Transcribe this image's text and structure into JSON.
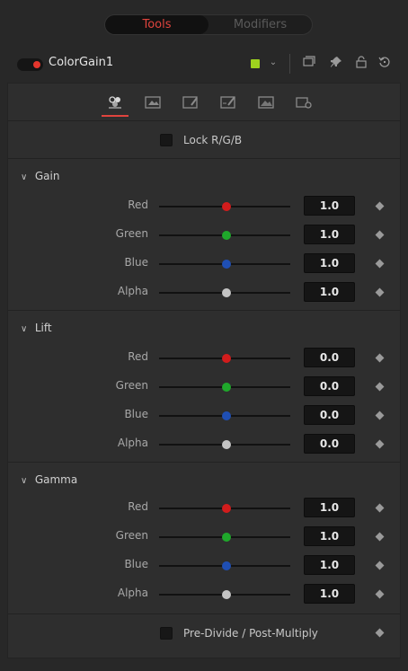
{
  "top_tabs": [
    {
      "label": "Tools",
      "active": true
    },
    {
      "label": "Modifiers",
      "active": false
    }
  ],
  "header": {
    "node_name": "ColorGain1",
    "enabled": true,
    "swatch_color": "#9ed31e",
    "icons": [
      "chevron-down-icon",
      "window-icon",
      "pin-icon",
      "lock-icon",
      "reset-icon"
    ]
  },
  "subtabs": [
    "controls-icon",
    "image-icon",
    "mask-icon",
    "mask-edit-icon",
    "image-output-icon",
    "settings-icon"
  ],
  "lock_rgb": {
    "label": "Lock R/G/B",
    "checked": false
  },
  "sections": [
    {
      "title": "Gain",
      "rows": [
        {
          "label": "Red",
          "value": "1.0",
          "color": "#d21c1c"
        },
        {
          "label": "Green",
          "value": "1.0",
          "color": "#1fa82b"
        },
        {
          "label": "Blue",
          "value": "1.0",
          "color": "#1f4fb4"
        },
        {
          "label": "Alpha",
          "value": "1.0",
          "color": "#c4c4c4"
        }
      ]
    },
    {
      "title": "Lift",
      "rows": [
        {
          "label": "Red",
          "value": "0.0",
          "color": "#d21c1c"
        },
        {
          "label": "Green",
          "value": "0.0",
          "color": "#1fa82b"
        },
        {
          "label": "Blue",
          "value": "0.0",
          "color": "#1f4fb4"
        },
        {
          "label": "Alpha",
          "value": "0.0",
          "color": "#c4c4c4"
        }
      ]
    },
    {
      "title": "Gamma",
      "rows": [
        {
          "label": "Red",
          "value": "1.0",
          "color": "#d21c1c"
        },
        {
          "label": "Green",
          "value": "1.0",
          "color": "#1fa82b"
        },
        {
          "label": "Blue",
          "value": "1.0",
          "color": "#1f4fb4"
        },
        {
          "label": "Alpha",
          "value": "1.0",
          "color": "#c4c4c4"
        }
      ]
    }
  ],
  "predivide": {
    "label": "Pre-Divide / Post-Multiply",
    "checked": false
  },
  "accent_color": "#e0443e"
}
